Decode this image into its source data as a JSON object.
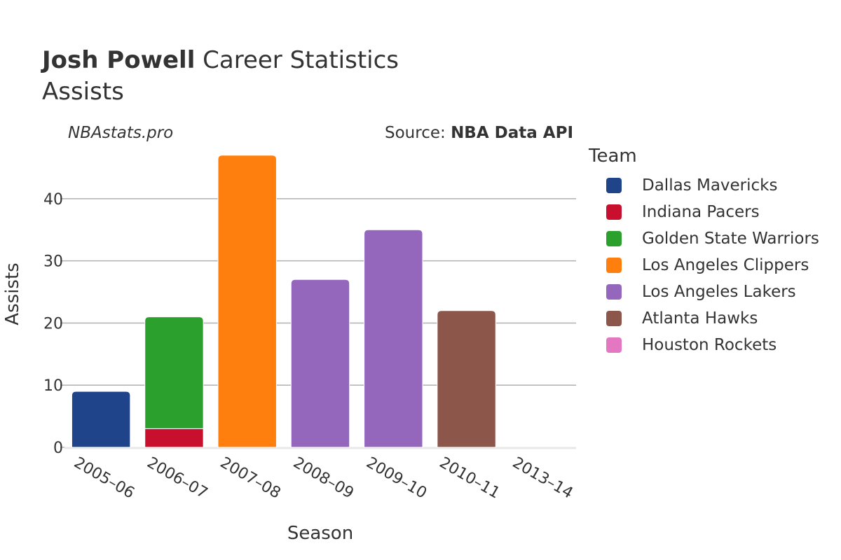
{
  "header": {
    "title_bold": "Josh Powell",
    "title_rest": " Career Statistics",
    "subtitle": "Assists",
    "watermark": "NBAstats.pro",
    "source_prefix": "Source: ",
    "source_bold": "NBA Data API"
  },
  "chart_data": {
    "type": "bar",
    "stacked": true,
    "title": "Josh Powell Career Statistics",
    "subtitle": "Assists",
    "xlabel": "Season",
    "ylabel": "Assists",
    "ylim": [
      0,
      49
    ],
    "yticks": [
      0,
      10,
      20,
      30,
      40
    ],
    "grid": true,
    "legend_title": "Team",
    "legend_position": "right",
    "categories": [
      "2005–06",
      "2006–07",
      "2007–08",
      "2008–09",
      "2009–10",
      "2010–11",
      "2013–14"
    ],
    "series": [
      {
        "name": "Dallas Mavericks",
        "color": "#1f4489",
        "values": [
          9,
          0,
          0,
          0,
          0,
          0,
          0
        ]
      },
      {
        "name": "Indiana Pacers",
        "color": "#c8102e",
        "values": [
          0,
          3,
          0,
          0,
          0,
          0,
          0
        ]
      },
      {
        "name": "Golden State Warriors",
        "color": "#2ca02c",
        "values": [
          0,
          18,
          0,
          0,
          0,
          0,
          0
        ]
      },
      {
        "name": "Los Angeles Clippers",
        "color": "#ff7f0e",
        "values": [
          0,
          0,
          47,
          0,
          0,
          0,
          0
        ]
      },
      {
        "name": "Los Angeles Lakers",
        "color": "#9467bd",
        "values": [
          0,
          0,
          0,
          27,
          35,
          0,
          0
        ]
      },
      {
        "name": "Atlanta Hawks",
        "color": "#8c564b",
        "values": [
          0,
          0,
          0,
          0,
          0,
          22,
          0
        ]
      },
      {
        "name": "Houston Rockets",
        "color": "#e377c2",
        "values": [
          0,
          0,
          0,
          0,
          0,
          0,
          0
        ]
      }
    ]
  }
}
